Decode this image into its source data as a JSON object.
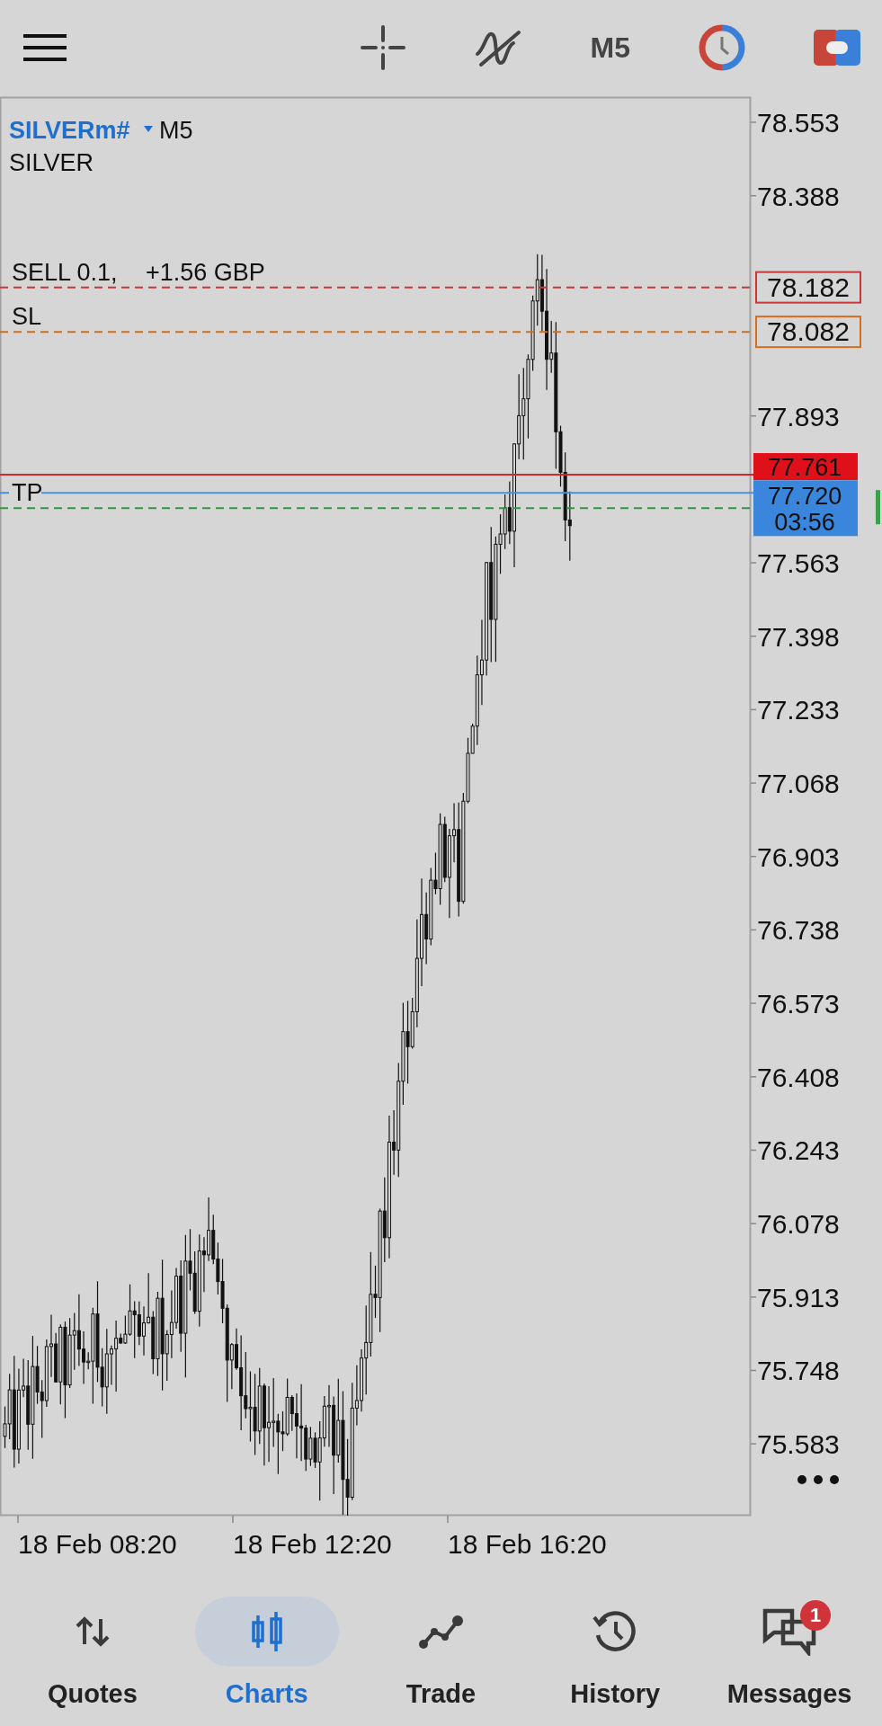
{
  "toolbar": {
    "timeframe": "M5"
  },
  "chart": {
    "symbol": "SILVERm#",
    "timeframe": "M5",
    "description": "SILVER",
    "order_lines": [
      {
        "kind": "sell",
        "label": "SELL 0.1,",
        "profit": "+1.56 GBP",
        "price": "78.182"
      },
      {
        "kind": "sl",
        "label": "SL",
        "price": "78.082"
      },
      {
        "kind": "tp",
        "label": "TP"
      }
    ],
    "ask": {
      "price": "77.761"
    },
    "bid": {
      "price": "77.720",
      "timer": "03:56"
    },
    "price_axis": [
      "78.553",
      "78.388",
      "77.893",
      "77.563",
      "77.398",
      "77.233",
      "77.068",
      "76.903",
      "76.738",
      "76.573",
      "76.408",
      "76.243",
      "76.078",
      "75.913",
      "75.748",
      "75.583"
    ],
    "time_axis": [
      "18 Feb 08:20",
      "18 Feb 12:20",
      "18 Feb 16:20"
    ]
  },
  "nav": [
    {
      "label": "Quotes",
      "selected": false
    },
    {
      "label": "Charts",
      "selected": true
    },
    {
      "label": "Trade",
      "selected": false
    },
    {
      "label": "History",
      "selected": false
    },
    {
      "label": "Messages",
      "selected": false,
      "badge": "1"
    }
  ]
}
